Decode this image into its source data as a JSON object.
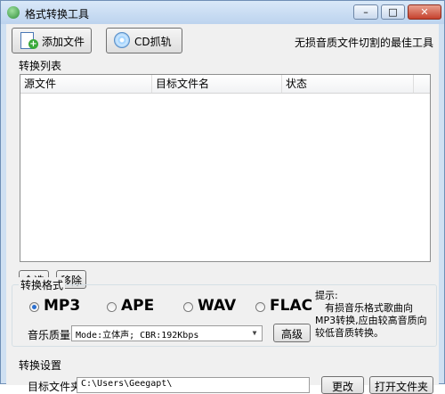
{
  "window": {
    "title": "格式转换工具",
    "minimize": "–",
    "maximize": "□",
    "close": "✕"
  },
  "toolbar": {
    "add_file_label": "添加文件",
    "cd_label": "CD抓轨",
    "tagline": "无损音质文件切割的最佳工具"
  },
  "conversion_list": {
    "label": "转换列表",
    "columns": [
      "源文件",
      "目标文件名",
      "状态"
    ],
    "select_all": "全选",
    "remove": "移除"
  },
  "format_section": {
    "label": "转换格式",
    "formats": [
      {
        "label": "MP3",
        "selected": true
      },
      {
        "label": "APE",
        "selected": false
      },
      {
        "label": "WAV",
        "selected": false
      },
      {
        "label": "FLAC",
        "selected": false
      }
    ],
    "quality_label": "音乐质量",
    "quality_value": "Mode:立体声; CBR:192Kbps",
    "advanced": "高级",
    "hint_title": "提示:",
    "hint_body": "有损音乐格式歌曲向MP3转换,应由较高音质向较低音质转换。"
  },
  "settings_section": {
    "label": "转换设置",
    "target_folder_label": "目标文件夹",
    "target_folder_value": "C:\\Users\\Geegapt\\",
    "change": "更改",
    "open_folder": "打开文件夹"
  },
  "colors": {
    "accent": "#2a6fcf",
    "frame": "#cfe0f2"
  }
}
